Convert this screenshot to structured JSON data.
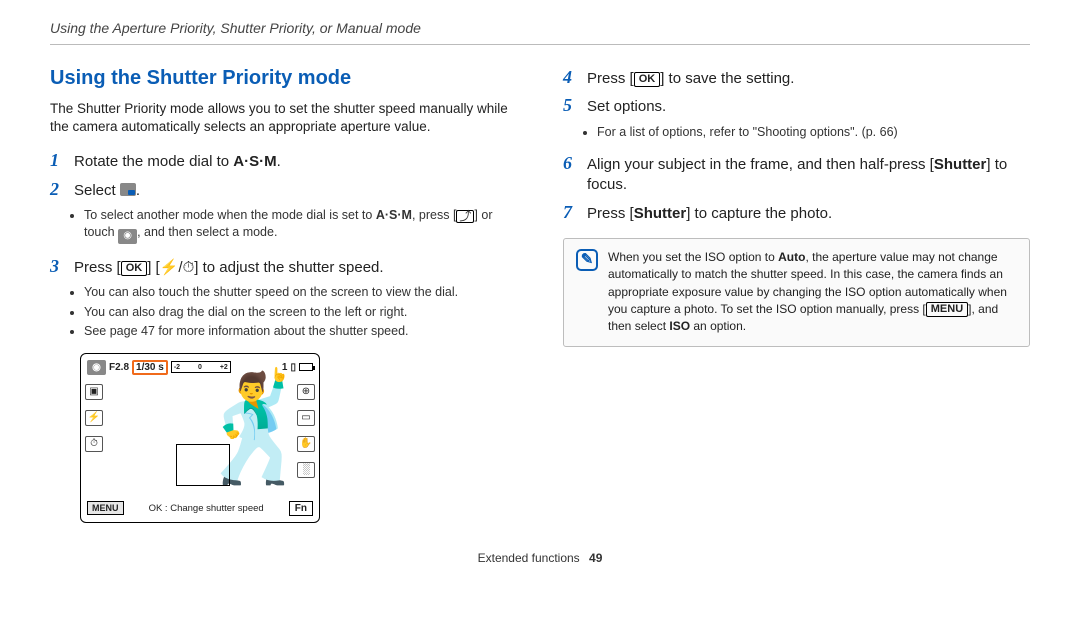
{
  "runningHead": "Using the Aperture Priority, Shutter Priority, or Manual mode",
  "heading": "Using the Shutter Priority mode",
  "intro": "The Shutter Priority mode allows you to set the shutter speed manually while the camera automatically selects an appropriate aperture value.",
  "steps": {
    "s1": {
      "num": "1",
      "pre": "Rotate the mode dial to ",
      "post": ".",
      "modeLabel": "A·S·M"
    },
    "s2": {
      "num": "2",
      "pre": "Select ",
      "post": ".",
      "sub": {
        "a_pre": "To select another mode when the mode dial is set to ",
        "a_mid": ", press [",
        "a_post": "] or touch ",
        "a_end": ", and then select a mode.",
        "mode": "A·S·M"
      }
    },
    "s3": {
      "num": "3",
      "pre": "Press [",
      "mid": "]     [",
      "post": "] to adjust the shutter speed.",
      "icons": {
        "flash": "⚡",
        "timer": "⏱"
      },
      "sub": {
        "a": "You can also touch the shutter speed on the screen to view the dial.",
        "b": "You can also drag the dial on the screen to the left or right.",
        "c": "See page 47 for more information about the shutter speed."
      }
    },
    "s4": {
      "num": "4",
      "pre": "Press [",
      "post": "] to save the setting."
    },
    "s5": {
      "num": "5",
      "text": "Set options.",
      "sub": {
        "a": "For a list of options, refer to \"Shooting options\". (p. 66)"
      }
    },
    "s6": {
      "num": "6",
      "pre": "Align your subject in the frame, and then half-press [",
      "shutter": "Shutter",
      "post": "] to focus."
    },
    "s7": {
      "num": "7",
      "pre": "Press [",
      "shutter": "Shutter",
      "post": "] to capture the photo."
    }
  },
  "okLabel": "OK",
  "menuLabel": "MENU",
  "isoLabel": "ISO",
  "note": {
    "pre": "When you set the ISO option to ",
    "auto": "Auto",
    "mid": ", the aperture value may not change automatically to match the shutter speed. In this case, the camera finds an appropriate exposure value by changing the ISO option automatically when you capture a photo. To set the ISO option manually, press [",
    "post": "], and then select ",
    "end": " an option."
  },
  "screenshot": {
    "aperture": "F2.8",
    "shutter": "1/30 s",
    "meterLo": "-2",
    "meterMid": "0",
    "meterHi": "+2",
    "count": "1",
    "menu": "MENU",
    "caption": "OK : Change shutter speed",
    "fn": "Fn"
  },
  "footer": {
    "section": "Extended functions",
    "page": "49"
  }
}
